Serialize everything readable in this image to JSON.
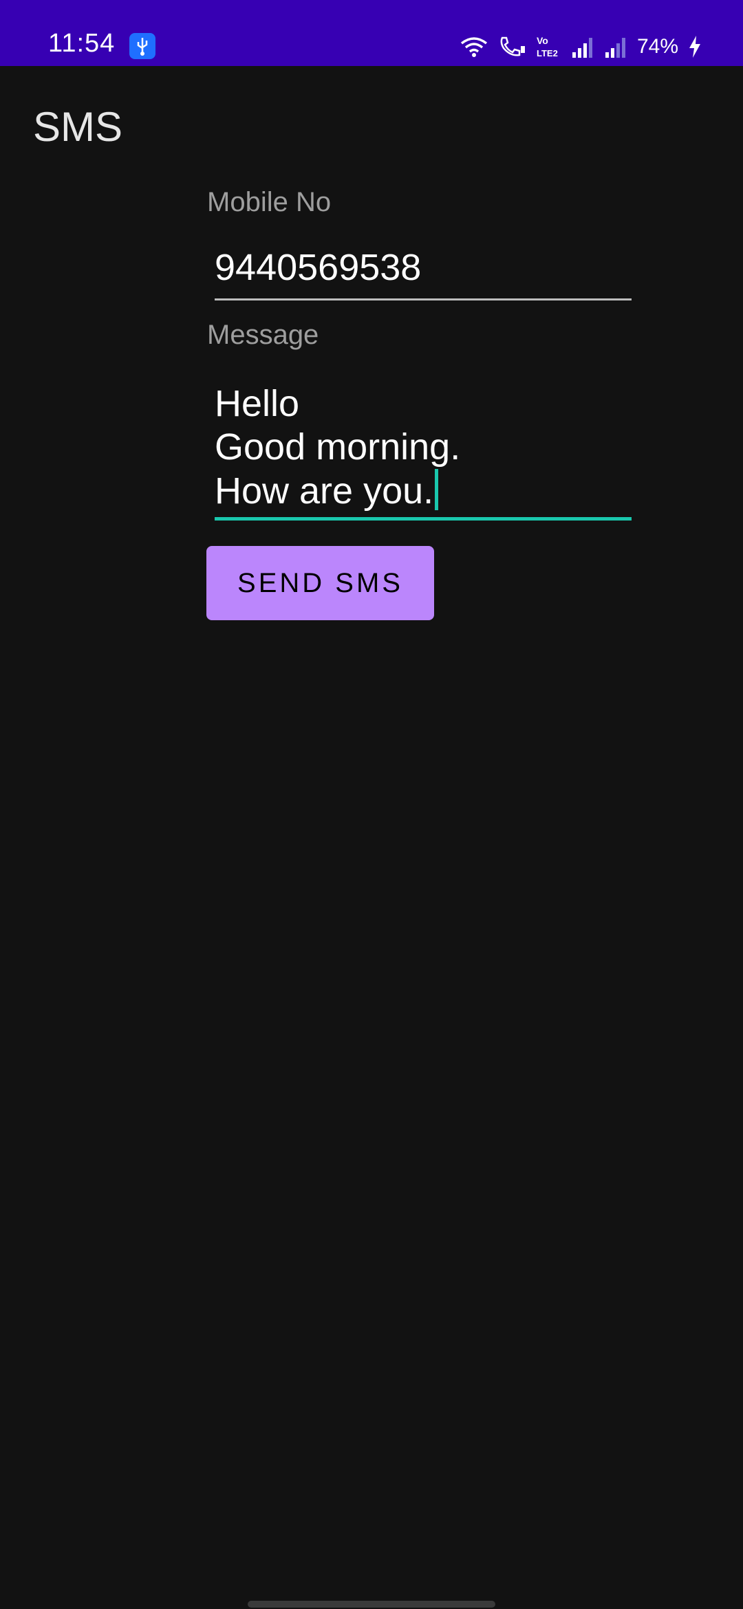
{
  "status_bar": {
    "time": "11:54",
    "battery": "74%",
    "icons": [
      "usb-icon",
      "wifi-icon",
      "wifi-call-icon",
      "volte-icon",
      "signal-icon",
      "signal-icon-2",
      "charging-icon"
    ],
    "volte_text": "Vo LTE2",
    "background_color": "#3700b3"
  },
  "app_bar": {
    "title": "SMS"
  },
  "form": {
    "mobile_label": "Mobile No",
    "mobile_value": "9440569538",
    "message_label": "Message",
    "message_value": "Hello\nGood morning.\nHow are you.",
    "send_button_label": "SEND SMS"
  },
  "colors": {
    "background": "#121212",
    "accent": "#1ac7ad",
    "button": "#bb86fc"
  }
}
